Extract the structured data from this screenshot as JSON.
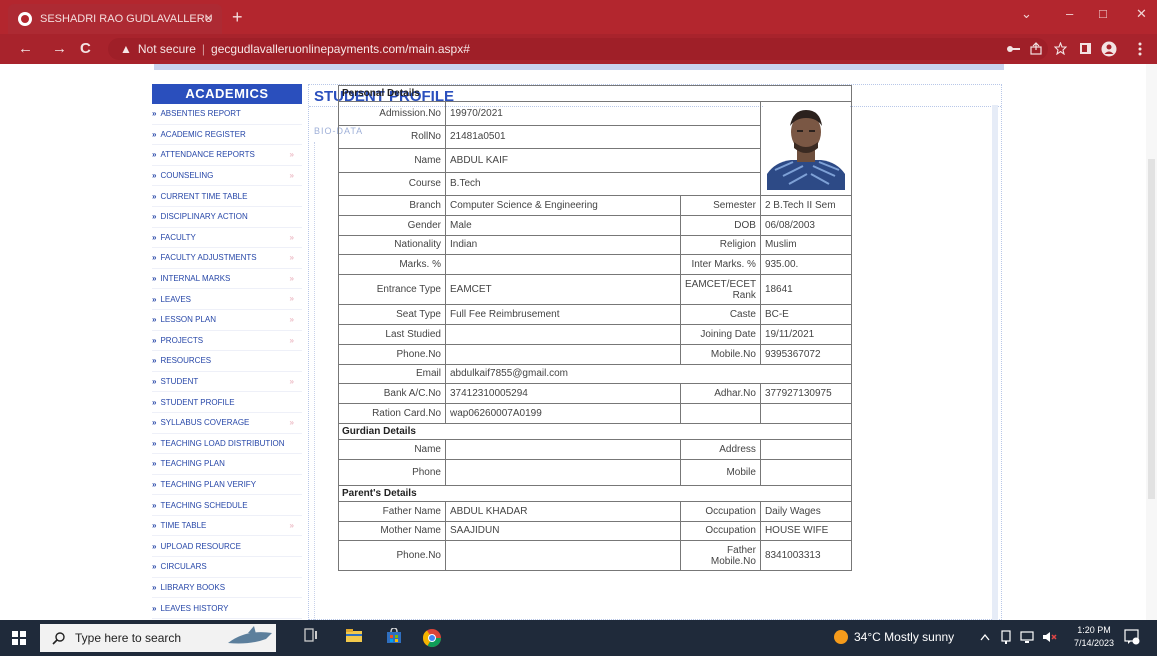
{
  "browser": {
    "tab_title": "SESHADRI RAO GUDLAVALLERU",
    "tab_close": "×",
    "new_tab": "+",
    "win_min": "–",
    "win_max": "□",
    "win_close": "✕",
    "win_down": "⌄",
    "back": "←",
    "forward": "→",
    "reload": "C",
    "not_secure": "Not secure",
    "url": "gecgudlavalleruonlinepayments.com/main.aspx#",
    "warn_icon": "▲"
  },
  "page": {
    "header_title": "STUDENT PROFILE",
    "bio_label": "BIO-DATA"
  },
  "sidebar": {
    "heading": "ACADEMICS",
    "items": [
      {
        "label": "ABSENTIES REPORT",
        "chev": ""
      },
      {
        "label": "ACADEMIC REGISTER",
        "chev": ""
      },
      {
        "label": "ATTENDANCE REPORTS",
        "chev": "»"
      },
      {
        "label": "COUNSELING",
        "chev": "»"
      },
      {
        "label": "CURRENT TIME TABLE",
        "chev": ""
      },
      {
        "label": "DISCIPLINARY ACTION",
        "chev": ""
      },
      {
        "label": "FACULTY",
        "chev": "»"
      },
      {
        "label": "FACULTY ADJUSTMENTS",
        "chev": "»"
      },
      {
        "label": "INTERNAL MARKS",
        "chev": "»"
      },
      {
        "label": "LEAVES",
        "chev": "»"
      },
      {
        "label": "LESSON PLAN",
        "chev": "»"
      },
      {
        "label": "PROJECTS",
        "chev": "»"
      },
      {
        "label": "RESOURCES",
        "chev": ""
      },
      {
        "label": "STUDENT",
        "chev": "»"
      },
      {
        "label": "STUDENT PROFILE",
        "chev": ""
      },
      {
        "label": "SYLLABUS COVERAGE",
        "chev": "»"
      },
      {
        "label": "TEACHING LOAD DISTRIBUTION",
        "chev": ""
      },
      {
        "label": "TEACHING PLAN",
        "chev": ""
      },
      {
        "label": "TEACHING PLAN VERIFY",
        "chev": ""
      },
      {
        "label": "TEACHING SCHEDULE",
        "chev": ""
      },
      {
        "label": "TIME TABLE",
        "chev": "»"
      },
      {
        "label": "UPLOAD RESOURCE",
        "chev": ""
      },
      {
        "label": "CIRCULARS",
        "chev": ""
      },
      {
        "label": "LIBRARY BOOKS",
        "chev": ""
      },
      {
        "label": "LEAVES HISTORY",
        "chev": ""
      }
    ]
  },
  "profile": {
    "personal_heading": "Personal Details",
    "admission_label": "Admission.No",
    "admission_value": "19970/2021",
    "roll_label": "RollNo",
    "roll_value": "21481a0501",
    "name_label": "Name",
    "name_value": "ABDUL KAIF",
    "course_label": "Course",
    "course_value": "B.Tech",
    "branch_label": "Branch",
    "branch_value": "Computer Science & Engineering",
    "semester_label": "Semester",
    "semester_value": "2 B.Tech II Sem",
    "gender_label": "Gender",
    "gender_value": "Male",
    "dob_label": "DOB",
    "dob_value": "06/08/2003",
    "nationality_label": "Nationality",
    "nationality_value": "Indian",
    "religion_label": "Religion",
    "religion_value": "Muslim",
    "marks_label": "Marks. %",
    "marks_value": "",
    "inter_marks_label": "Inter Marks. %",
    "inter_marks_value": "935.00.",
    "entrance_label": "Entrance Type",
    "entrance_value": "EAMCET",
    "eamcet_rank_label": "EAMCET/ECET Rank",
    "eamcet_rank_value": "18641",
    "seat_label": "Seat Type",
    "seat_value": "Full Fee Reimbrusement",
    "caste_label": "Caste",
    "caste_value": "BC-E",
    "last_studied_label": "Last Studied",
    "last_studied_value": "",
    "joining_label": "Joining Date",
    "joining_value": "19/11/2021",
    "phone_label": "Phone.No",
    "phone_value": "",
    "mobile_label": "Mobile.No",
    "mobile_value": "9395367072",
    "email_label": "Email",
    "email_value": "abdulkaif7855@gmail.com",
    "bank_label": "Bank A/C.No",
    "bank_value": "37412310005294",
    "adhar_label": "Adhar.No",
    "adhar_value": "377927130975",
    "ration_label": "Ration Card.No",
    "ration_value": "wap06260007A0199",
    "guardian_heading": "Gurdian Details",
    "g_name_label": "Name",
    "g_name_value": "",
    "g_address_label": "Address",
    "g_address_value": "",
    "g_phone_label": "Phone",
    "g_phone_value": "",
    "g_mobile_label": "Mobile",
    "g_mobile_value": "",
    "parents_heading": "Parent's Details",
    "father_label": "Father Name",
    "father_value": "ABDUL KHADAR",
    "f_occ_label": "Occupation",
    "f_occ_value": "Daily Wages",
    "mother_label": "Mother Name",
    "mother_value": "SAAJIDUN",
    "m_occ_label": "Occupation",
    "m_occ_value": "HOUSE WIFE",
    "p_phone_label": "Phone.No",
    "p_phone_value": "",
    "father_mobile_label": "Father Mobile.No",
    "father_mobile_value": "8341003313"
  },
  "taskbar": {
    "search_placeholder": "Type here to search",
    "weather": "34°C  Mostly sunny",
    "time": "1:20 PM",
    "date": "7/14/2023"
  },
  "colors": {
    "chrome_red": "#b3262e",
    "sidebar_blue": "#2a4fbd",
    "taskbar": "#1f2a3a"
  }
}
